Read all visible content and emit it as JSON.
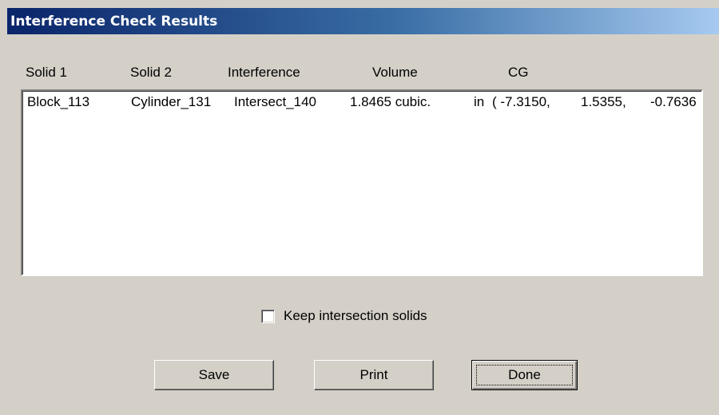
{
  "window": {
    "title": "Interference Check Results"
  },
  "columns": [
    "Solid 1",
    "Solid 2",
    "Interference",
    "Volume",
    "CG"
  ],
  "rows": [
    {
      "solid1": "Block_113",
      "solid2": "Cylinder_131",
      "interference": "Intersect_140",
      "volume": "1.8465 cubic.",
      "unit": "in",
      "cg_x": "( -7.3150,",
      "cg_y": "1.5355,",
      "cg_z": "-0.7636"
    }
  ],
  "options": {
    "keep_intersection_label": "Keep intersection solids",
    "keep_intersection_checked": false
  },
  "buttons": {
    "save": "Save",
    "print": "Print",
    "done": "Done"
  },
  "colors": {
    "dialog_bg": "#d4d0c8",
    "titlebar_start": "#0a246a",
    "titlebar_end": "#a6caf0"
  }
}
